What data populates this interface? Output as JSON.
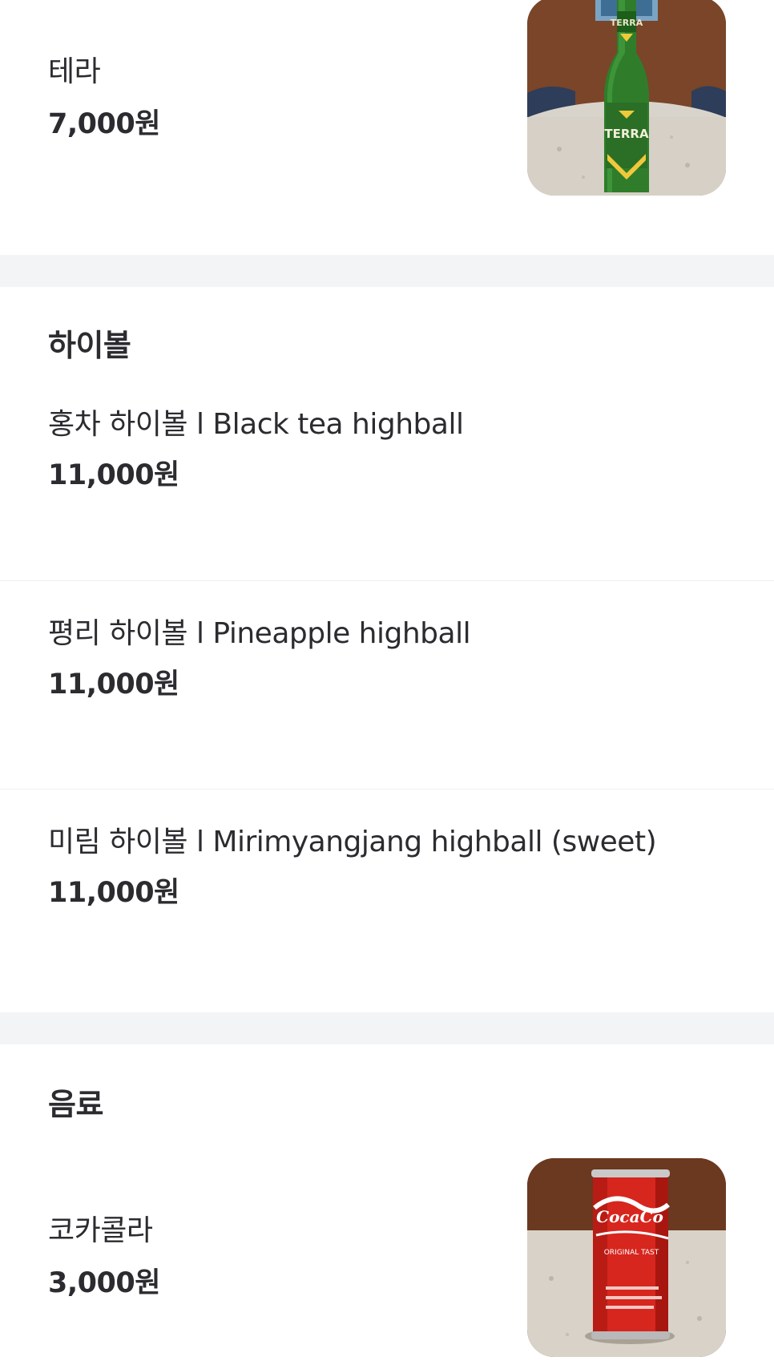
{
  "items_top": {
    "terra": {
      "name": "테라",
      "price": "7,000원",
      "image": "terra-beer-bottle"
    }
  },
  "sections": {
    "highball": {
      "title": "하이볼",
      "items": [
        {
          "name": "홍차 하이볼 l Black tea highball",
          "price": "11,000원"
        },
        {
          "name": "평리 하이볼 l Pineapple highball",
          "price": "11,000원"
        },
        {
          "name": "미림 하이볼 l Mirimyangjang highball (sweet)",
          "price": "11,000원"
        }
      ]
    },
    "drinks": {
      "title": "음료",
      "items": [
        {
          "name": "코카콜라",
          "price": "3,000원",
          "image": "coca-cola-can"
        }
      ]
    }
  },
  "colors": {
    "text": "#2b2b30",
    "section_gap": "#f2f4f5",
    "terra_green": "#2f7d2a",
    "coke_red": "#d7261e"
  }
}
